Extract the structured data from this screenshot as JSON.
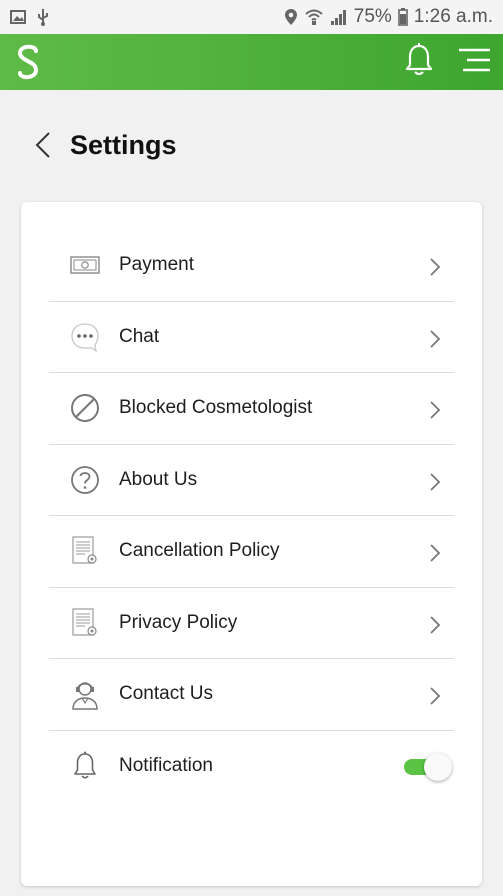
{
  "status_bar": {
    "battery": "75%",
    "time": "1:26 a.m."
  },
  "app_bar": {
    "logo": "S",
    "colors": {
      "primary": "#4db03c",
      "accent": "#5ac344"
    },
    "icons": [
      "logo-icon",
      "bell-icon",
      "menu-icon"
    ]
  },
  "header": {
    "title": "Settings"
  },
  "settings": {
    "items": [
      {
        "label": "Payment",
        "icon": "payment-icon"
      },
      {
        "label": "Chat",
        "icon": "chat-icon"
      },
      {
        "label": "Blocked Cosmetologist",
        "icon": "blocked-icon"
      },
      {
        "label": "About Us",
        "icon": "question-icon"
      },
      {
        "label": "Cancellation Policy",
        "icon": "document-icon"
      },
      {
        "label": "Privacy Policy",
        "icon": "document-icon"
      },
      {
        "label": "Contact Us",
        "icon": "support-agent-icon"
      },
      {
        "label": "Notification",
        "icon": "bell-icon",
        "toggle_on": true
      }
    ]
  }
}
